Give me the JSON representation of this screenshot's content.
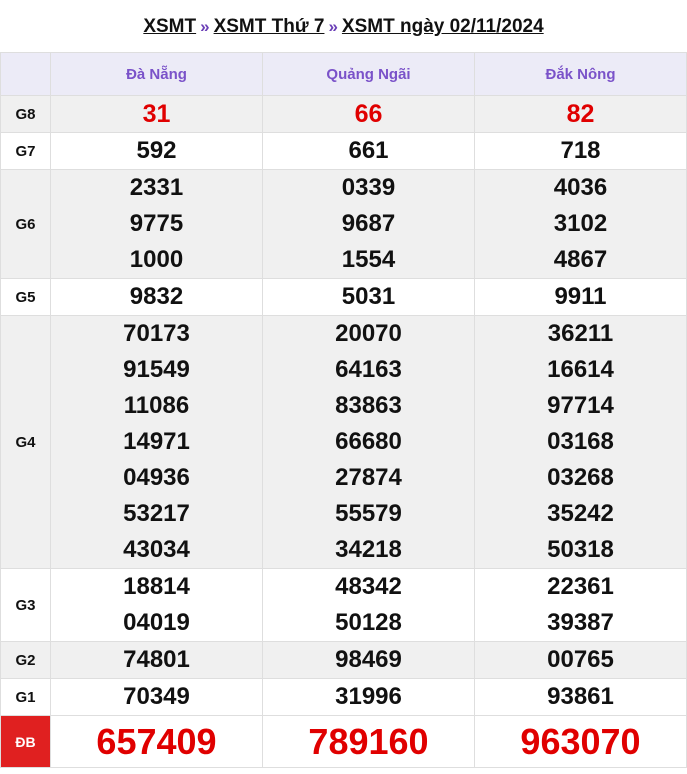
{
  "breadcrumb": {
    "items": [
      "XSMT",
      "XSMT Thứ 7",
      "XSMT ngày 02/11/2024"
    ],
    "separator": "»"
  },
  "table": {
    "provinces": [
      "Đà Nẵng",
      "Quảng Ngãi",
      "Đắk Nông"
    ],
    "prizes": [
      {
        "label": "G8",
        "results": [
          [
            "31"
          ],
          [
            "66"
          ],
          [
            "82"
          ]
        ]
      },
      {
        "label": "G7",
        "results": [
          [
            "592"
          ],
          [
            "661"
          ],
          [
            "718"
          ]
        ]
      },
      {
        "label": "G6",
        "results": [
          [
            "2331",
            "9775",
            "1000"
          ],
          [
            "0339",
            "9687",
            "1554"
          ],
          [
            "4036",
            "3102",
            "4867"
          ]
        ]
      },
      {
        "label": "G5",
        "results": [
          [
            "9832"
          ],
          [
            "5031"
          ],
          [
            "9911"
          ]
        ]
      },
      {
        "label": "G4",
        "results": [
          [
            "70173",
            "91549",
            "11086",
            "14971",
            "04936",
            "53217",
            "43034"
          ],
          [
            "20070",
            "64163",
            "83863",
            "66680",
            "27874",
            "55579",
            "34218"
          ],
          [
            "36211",
            "16614",
            "97714",
            "03168",
            "03268",
            "35242",
            "50318"
          ]
        ]
      },
      {
        "label": "G3",
        "results": [
          [
            "18814",
            "04019"
          ],
          [
            "48342",
            "50128"
          ],
          [
            "22361",
            "39387"
          ]
        ]
      },
      {
        "label": "G2",
        "results": [
          [
            "74801"
          ],
          [
            "98469"
          ],
          [
            "00765"
          ]
        ]
      },
      {
        "label": "G1",
        "results": [
          [
            "70349"
          ],
          [
            "31996"
          ],
          [
            "93861"
          ]
        ]
      },
      {
        "label": "ĐB",
        "results": [
          [
            "657409"
          ],
          [
            "789160"
          ],
          [
            "963070"
          ]
        ]
      }
    ]
  },
  "colors": {
    "header_bg": "#ecebf7",
    "header_text": "#7a52c9",
    "accent_red": "#e00000",
    "special_label_bg": "#e02020",
    "row_gray": "#f0f0f0"
  }
}
